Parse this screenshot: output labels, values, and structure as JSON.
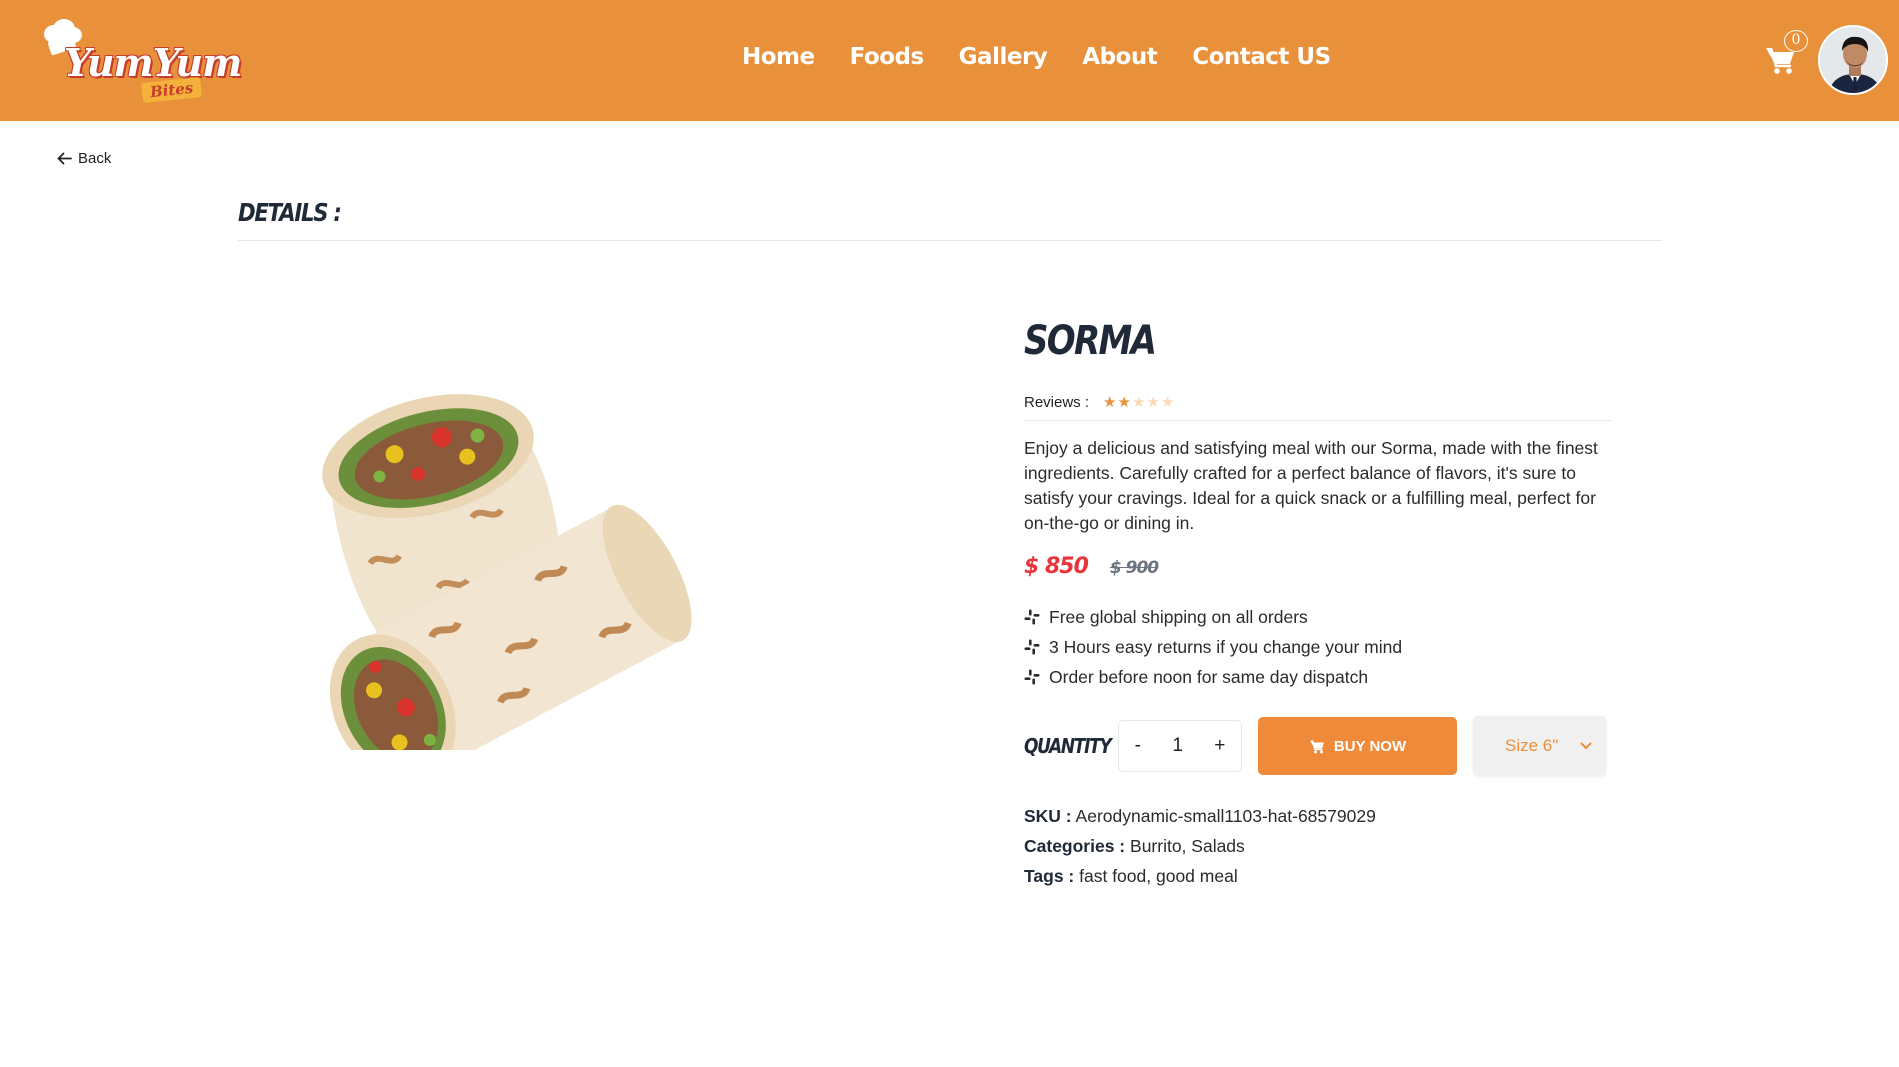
{
  "header": {
    "logo": {
      "text": "YumYum",
      "subtext": "Bites"
    },
    "nav": [
      "Home",
      "Foods",
      "Gallery",
      "About",
      "Contact US"
    ],
    "cart_count": "0",
    "brand_color": "#e8913a"
  },
  "back_label": "Back",
  "details_title": "Details :",
  "product": {
    "name": "Sorma",
    "reviews_label": "Reviews :",
    "rating": 2,
    "rating_max": 5,
    "description": "Enjoy a delicious and satisfying meal with our Sorma, made with the finest ingredients. Carefully crafted for a perfect balance of flavors, it's sure to satisfy your cravings. Ideal for a quick snack or a fulfilling meal, perfect for on-the-go or dining in.",
    "price_current": "$ 850",
    "price_old": "$ 900",
    "features": [
      "Free global shipping on all orders",
      "3 Hours easy returns if you change your mind",
      "Order before noon for same day dispatch"
    ],
    "quantity_label": "Quantity",
    "quantity": "1",
    "qty_minus": "-",
    "qty_plus": "+",
    "buy_label": "BUY NOW",
    "size": "Size 6\"",
    "sku_label": "SKU :",
    "sku": "Aerodynamic-small1103-hat-68579029",
    "categories_label": "Categories :",
    "categories": "Burrito, Salads",
    "tags_label": "Tags :",
    "tags": "fast food, good meal"
  },
  "colors": {
    "header": "#e8913a",
    "button": "#ef8a3a",
    "price": "#e8343a",
    "star": "#e8913a"
  },
  "icons": [
    "chef-hat-icon",
    "cart-icon",
    "arrow-left-icon",
    "star-icon",
    "slack-icon",
    "chevron-down-icon"
  ]
}
